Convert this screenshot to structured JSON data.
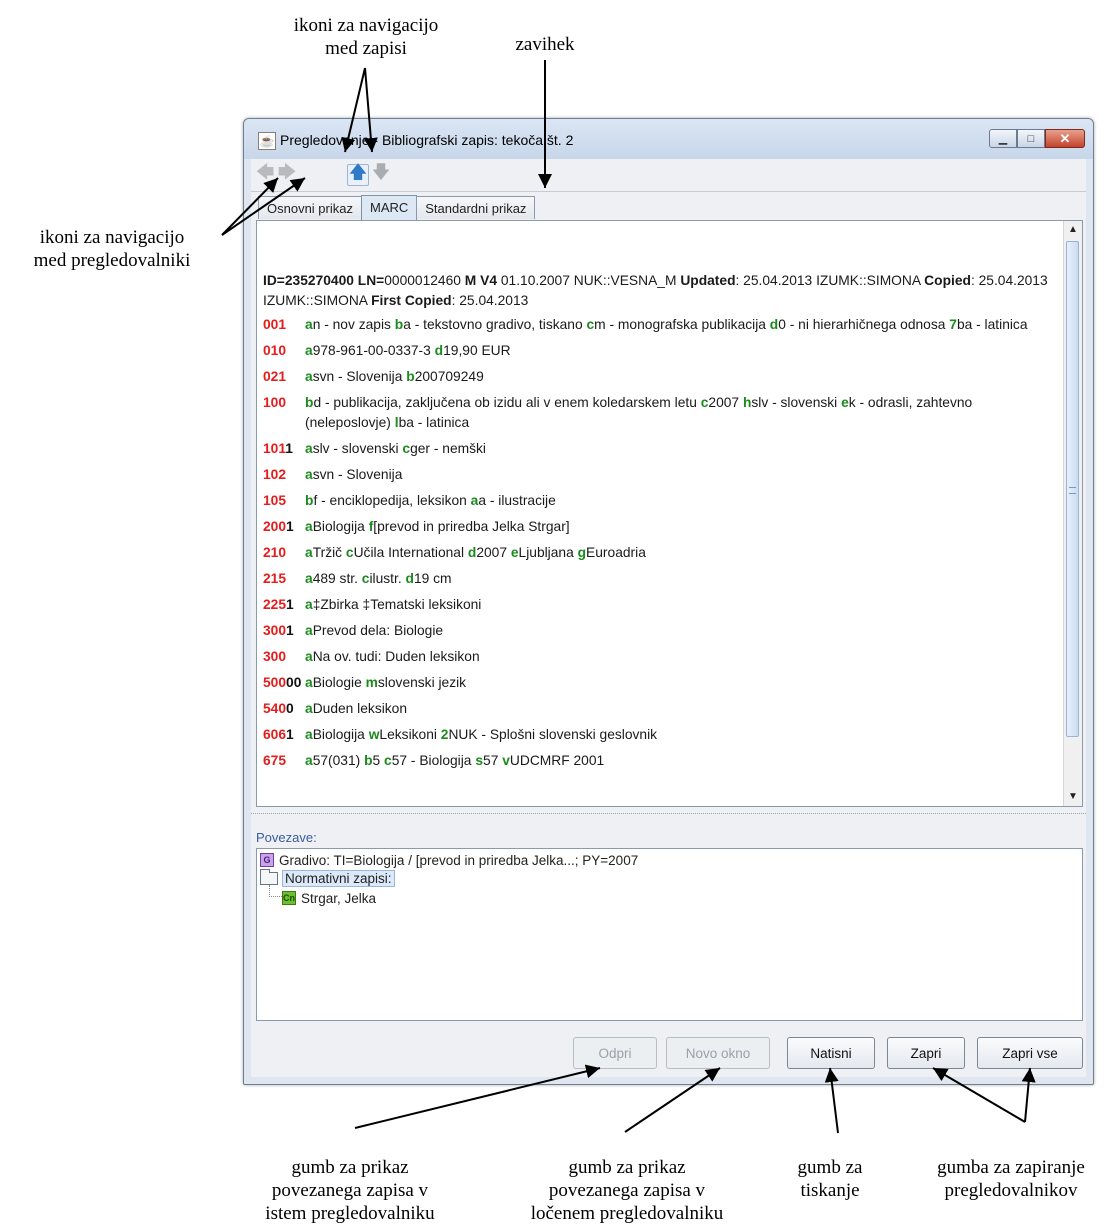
{
  "window": {
    "title": "Pregledovanje - Bibliografski zapis: tekoča št. 2",
    "app_icon": "java-icon",
    "controls": {
      "minimize": "▁",
      "maximize": "□",
      "close": "✕"
    }
  },
  "toolbar": {
    "back": "🡄",
    "forward": "🡆",
    "up": "🡅",
    "down": "🡇"
  },
  "tabs": [
    {
      "label": "Osnovni prikaz",
      "active": false
    },
    {
      "label": "MARC",
      "active": true
    },
    {
      "label": "Standardni prikaz",
      "active": false
    }
  ],
  "marc": {
    "header": {
      "id_label": "ID=235270400",
      "ln_label": "LN=",
      "ln_value": "0000012460",
      "mv": "M V4",
      "created": "01.10.2007 NUK::VESNA_M",
      "updated_label": "Updated",
      "updated": ": 25.04.2013 IZUMK::SIMONA",
      "copied_label": "Copied",
      "copied": ": 25.04.2013 IZUMK::SIMONA",
      "first_copied_label": "First Copied",
      "first_copied": ": 25.04.2013"
    },
    "fields": [
      {
        "tag": "001",
        "ind": "",
        "parts": [
          [
            "a",
            "n - nov zapis "
          ],
          [
            "b",
            "a - tekstovno gradivo, tiskano "
          ],
          [
            "c",
            "m - monografska publikacija "
          ],
          [
            "d",
            "0 - ni hierarhičnega odnosa "
          ],
          [
            "7",
            "ba - latinica"
          ]
        ]
      },
      {
        "tag": "010",
        "ind": "",
        "parts": [
          [
            "a",
            "978-961-00-0337-3 "
          ],
          [
            "d",
            "19,90 EUR"
          ]
        ]
      },
      {
        "tag": "021",
        "ind": "",
        "parts": [
          [
            "a",
            "svn - Slovenija "
          ],
          [
            "b",
            "200709249"
          ]
        ]
      },
      {
        "tag": "100",
        "ind": "",
        "parts": [
          [
            "b",
            "d - publikacija, zaključena ob izidu ali v enem koledarskem letu "
          ],
          [
            "c",
            "2007 "
          ],
          [
            "h",
            "slv - slovenski "
          ],
          [
            "e",
            "k - odrasli, zahtevno (neleposlovje) "
          ],
          [
            "l",
            "ba - latinica"
          ]
        ]
      },
      {
        "tag": "101",
        "ind": "1",
        "parts": [
          [
            "a",
            "slv - slovenski "
          ],
          [
            "c",
            "ger - nemški"
          ]
        ]
      },
      {
        "tag": "102",
        "ind": "",
        "parts": [
          [
            "a",
            "svn - Slovenija"
          ]
        ]
      },
      {
        "tag": "105",
        "ind": "",
        "parts": [
          [
            "b",
            "f - enciklopedija, leksikon "
          ],
          [
            "a",
            "a - ilustracije"
          ]
        ]
      },
      {
        "tag": "200",
        "ind": "1",
        "parts": [
          [
            "a",
            "Biologija "
          ],
          [
            "f",
            "[prevod in priredba Jelka Strgar]"
          ]
        ]
      },
      {
        "tag": "210",
        "ind": "",
        "parts": [
          [
            "a",
            "Tržič "
          ],
          [
            "c",
            "Učila International "
          ],
          [
            "d",
            "2007 "
          ],
          [
            "e",
            "Ljubljana "
          ],
          [
            "g",
            "Euroadria"
          ]
        ]
      },
      {
        "tag": "215",
        "ind": "",
        "parts": [
          [
            "a",
            "489 str. "
          ],
          [
            "c",
            "ilustr. "
          ],
          [
            "d",
            "19 cm"
          ]
        ]
      },
      {
        "tag": "225",
        "ind": "1",
        "parts": [
          [
            "a",
            "‡Zbirka ‡Tematski leksikoni"
          ]
        ]
      },
      {
        "tag": "300",
        "ind": "1",
        "parts": [
          [
            "a",
            "Prevod dela: Biologie"
          ]
        ]
      },
      {
        "tag": "300",
        "ind": "",
        "parts": [
          [
            "a",
            "Na ov. tudi: Duden leksikon"
          ]
        ]
      },
      {
        "tag": "500",
        "ind": "00",
        "parts": [
          [
            "a",
            "Biologie "
          ],
          [
            "m",
            "slovenski jezik"
          ]
        ]
      },
      {
        "tag": "540",
        "ind": "0",
        "parts": [
          [
            "a",
            "Duden leksikon"
          ]
        ]
      },
      {
        "tag": "606",
        "ind": "1",
        "parts": [
          [
            "a",
            "Biologija "
          ],
          [
            "w",
            "Leksikoni "
          ],
          [
            "2",
            "NUK - Splošni slovenski geslovnik"
          ]
        ]
      },
      {
        "tag": "675",
        "ind": "",
        "parts": [
          [
            "a",
            "57(031) "
          ],
          [
            "b",
            "5 "
          ],
          [
            "c",
            "57 - Biologija "
          ],
          [
            "s",
            "57 "
          ],
          [
            "v",
            "UDCMRF 2001"
          ]
        ]
      }
    ]
  },
  "links": {
    "label": "Povezave:",
    "gradivo_badge": "G",
    "gradivo": "Gradivo: TI=Biologija / [prevod in priredba Jelka...; PY=2007",
    "normative": "Normativni zapisi:",
    "author_badge": "Cn",
    "author": "Strgar, Jelka"
  },
  "buttons": {
    "odpri": "Odpri",
    "novo_okno": "Novo okno",
    "natisni": "Natisni",
    "zapri": "Zapri",
    "zapri_vse": "Zapri vse"
  },
  "annotations": {
    "nav_records": "ikoni za navigacijo\nmed zapisi",
    "tab": "zavihek",
    "nav_viewers": "ikoni za navigacijo\nmed pregledovalniki",
    "btn_same": "gumb za prikaz\npovezanega zapisa v\nistem pregledovalniku",
    "btn_new": "gumb za prikaz\npovezanega zapisa v\nločenem pregledovalniku",
    "btn_print": "gumb za\ntiskanje",
    "btn_close": "gumba za zapiranje\npregledovalnikov"
  }
}
